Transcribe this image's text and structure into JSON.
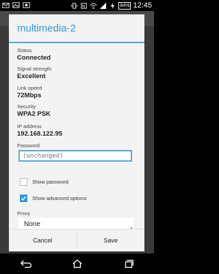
{
  "status_bar": {
    "battery": "84%",
    "time": "12:45",
    "icons": [
      "mail-icon",
      "photo-icon",
      "image-icon",
      "vibrate-icon",
      "nfc-icon",
      "wifi-icon",
      "signal-icon",
      "battery-charging-icon"
    ]
  },
  "dialog": {
    "title": "multimedia-2",
    "accent": "#2f9bd6",
    "status_label": "Status",
    "status_value": "Connected",
    "signal_label": "Signal strength",
    "signal_value": "Excellent",
    "link_label": "Link speed",
    "link_value": "72Mbps",
    "security_label": "Security",
    "security_value": "WPA2 PSK",
    "ip_label": "IP address",
    "ip_value": "192.168.122.95",
    "password_label": "Password",
    "password_placeholder": "(unchanged)",
    "show_password_label": "Show password",
    "show_password_checked": false,
    "show_advanced_label": "Show advanced options",
    "show_advanced_checked": true,
    "proxy_label": "Proxy",
    "proxy_value": "None"
  },
  "footer": {
    "cancel_label": "Cancel",
    "save_label": "Save"
  },
  "navbar": {
    "icons": [
      "back-icon",
      "home-icon",
      "recent-apps-icon"
    ]
  }
}
